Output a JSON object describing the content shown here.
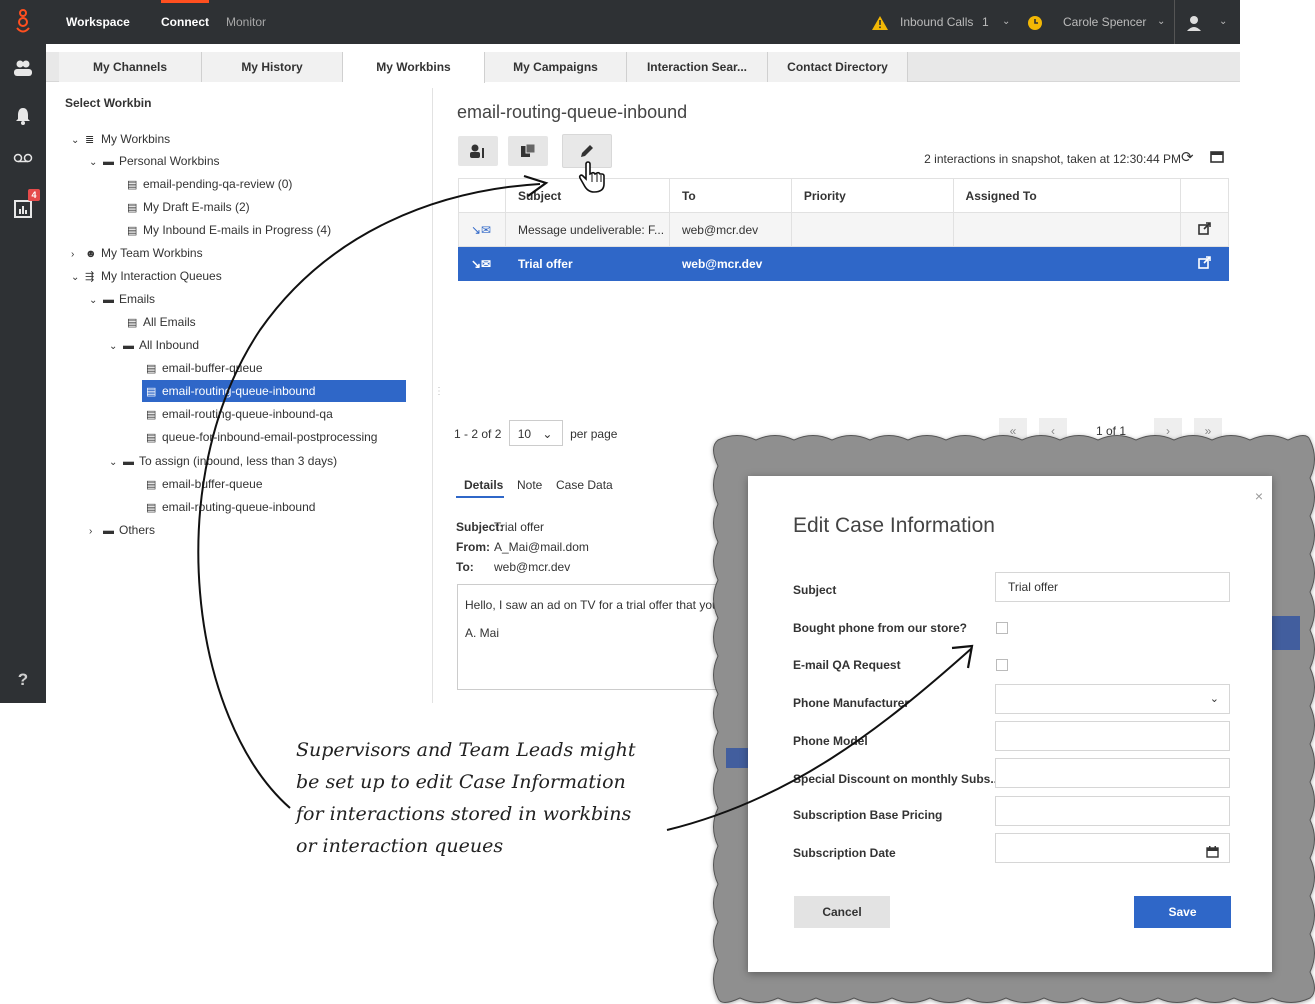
{
  "topbar": {
    "workspace": "Workspace",
    "connect": "Connect",
    "monitor": "Monitor",
    "inbound_calls_label": "Inbound Calls",
    "inbound_calls_count": "1",
    "user_name": "Carole Spencer"
  },
  "leftbar": {
    "badge_count": "4",
    "help": "?"
  },
  "tabs": [
    {
      "label": "My Channels"
    },
    {
      "label": "My History"
    },
    {
      "label": "My Workbins"
    },
    {
      "label": "My Campaigns"
    },
    {
      "label": "Interaction Sear..."
    },
    {
      "label": "Contact Directory"
    }
  ],
  "tree": {
    "header": "Select Workbin",
    "items": [
      {
        "label": "My Workbins"
      },
      {
        "label": "Personal Workbins"
      },
      {
        "label": "email-pending-qa-review (0)"
      },
      {
        "label": "My Draft E-mails (2)"
      },
      {
        "label": "My Inbound E-mails in Progress (4)"
      },
      {
        "label": "My Team Workbins"
      },
      {
        "label": "My Interaction Queues"
      },
      {
        "label": "Emails"
      },
      {
        "label": "All Emails"
      },
      {
        "label": "All Inbound"
      },
      {
        "label": "email-buffer-queue"
      },
      {
        "label": "email-routing-queue-inbound"
      },
      {
        "label": "email-routing-queue-inbound-qa"
      },
      {
        "label": "queue-for-inbound-email-postprocessing"
      },
      {
        "label": "To assign (inbound, less than 3 days)"
      },
      {
        "label": "email-buffer-queue"
      },
      {
        "label": "email-routing-queue-inbound"
      },
      {
        "label": "Others"
      }
    ]
  },
  "workbin": {
    "title": "email-routing-queue-inbound",
    "snapshot": "2 interactions in snapshot, taken at 12:30:44 PM",
    "columns": [
      "Subject",
      "To",
      "Priority",
      "Assigned To"
    ],
    "rows": [
      {
        "subject": "Message undeliverable: F...",
        "to": "web@mcr.dev",
        "priority": "",
        "assigned": ""
      },
      {
        "subject": "Trial offer",
        "to": "web@mcr.dev",
        "priority": "",
        "assigned": ""
      }
    ],
    "pager": {
      "range": "1 - 2 of 2",
      "page_size": "10",
      "per_page": "per page",
      "page": "1 of 1"
    }
  },
  "details": {
    "tabs": [
      "Details",
      "Note",
      "Case Data"
    ],
    "subject_label": "Subject:",
    "subject_value": "Trial offer",
    "from_label": "From:",
    "from_value": "A_Mai@mail.dom",
    "to_label": "To:",
    "to_value": "web@mcr.dev",
    "body_line1": "Hello, I saw an ad on TV for a trial offer that you ha",
    "body_line2": "A. Mai"
  },
  "dialog": {
    "title": "Edit Case Information",
    "close": "×",
    "fields": [
      {
        "label": "Subject",
        "value": "Trial offer"
      },
      {
        "label": "Bought phone from our store?",
        "value": ""
      },
      {
        "label": "E-mail QA Request",
        "value": ""
      },
      {
        "label": "Phone Manufacturer",
        "value": ""
      },
      {
        "label": "Phone Model",
        "value": ""
      },
      {
        "label": "Special Discount on monthly Subs...",
        "value": ""
      },
      {
        "label": "Subscription Base Pricing",
        "value": ""
      },
      {
        "label": "Subscription Date",
        "value": ""
      }
    ],
    "cancel": "Cancel",
    "save": "Save"
  },
  "annotation": {
    "lines": [
      "Supervisors and Team Leads might",
      "be set up to edit Case Information",
      "for interactions stored in workbins",
      "or interaction queues"
    ]
  },
  "colors": {
    "accent": "#2f67c8",
    "brand": "#ff4f1f",
    "dark": "#2e3134"
  }
}
